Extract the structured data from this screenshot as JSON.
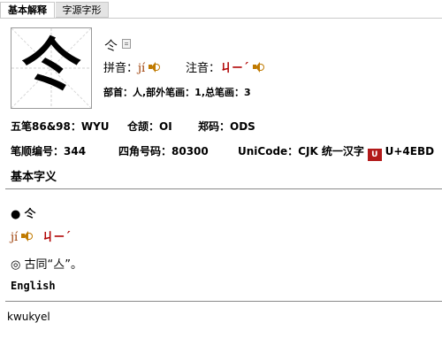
{
  "tabs": {
    "basic": "基本解释",
    "origin": "字源字形"
  },
  "character": {
    "glyph": "仒",
    "pinyin_label": "拼音：",
    "pinyin": "jí",
    "zhuyin_label": "注音：",
    "zhuyin": "ㄐㄧˊ",
    "radical_info": "部首：人,部外笔画：1,总笔画：3"
  },
  "codes": {
    "wubi": "五笔86&98：WYU",
    "cangjie": "仓颉：OI",
    "zhengma": "郑码：ODS",
    "stroke_order": "笔顺编号：344",
    "four_corner": "四角号码：80300",
    "unicode_label": "UniCode：CJK 统一汉字",
    "unicode_value": "U+4EBD"
  },
  "basic_meaning": {
    "heading": "基本字义",
    "bullet": "●",
    "char": "仒",
    "pinyin": "jí",
    "zhuyin": "ㄐㄧˊ",
    "circle": "◎",
    "definition": "古同“亼”。"
  },
  "english": {
    "heading": "English",
    "text": "kwukyel"
  },
  "colors": {
    "pinyin": "#9b3a00",
    "zhuyin": "#b00000",
    "speaker": "#c07a00"
  }
}
